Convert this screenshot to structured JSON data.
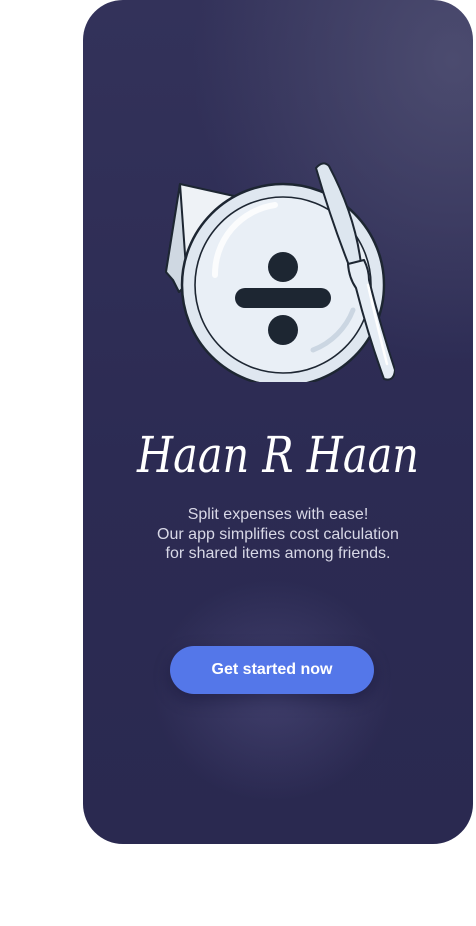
{
  "app": {
    "name": "Haan R Haan",
    "tagline": {
      "line1": "Split expenses with ease!",
      "line2": "Our app simplifies cost calculation",
      "line3": "for shared items among friends."
    },
    "cta_label": "Get started now"
  },
  "colors": {
    "background": "#2c2b53",
    "accent": "#5477e9",
    "text": "#d8d8e6"
  },
  "icons": {
    "illustration": "plate-divide-icon"
  }
}
